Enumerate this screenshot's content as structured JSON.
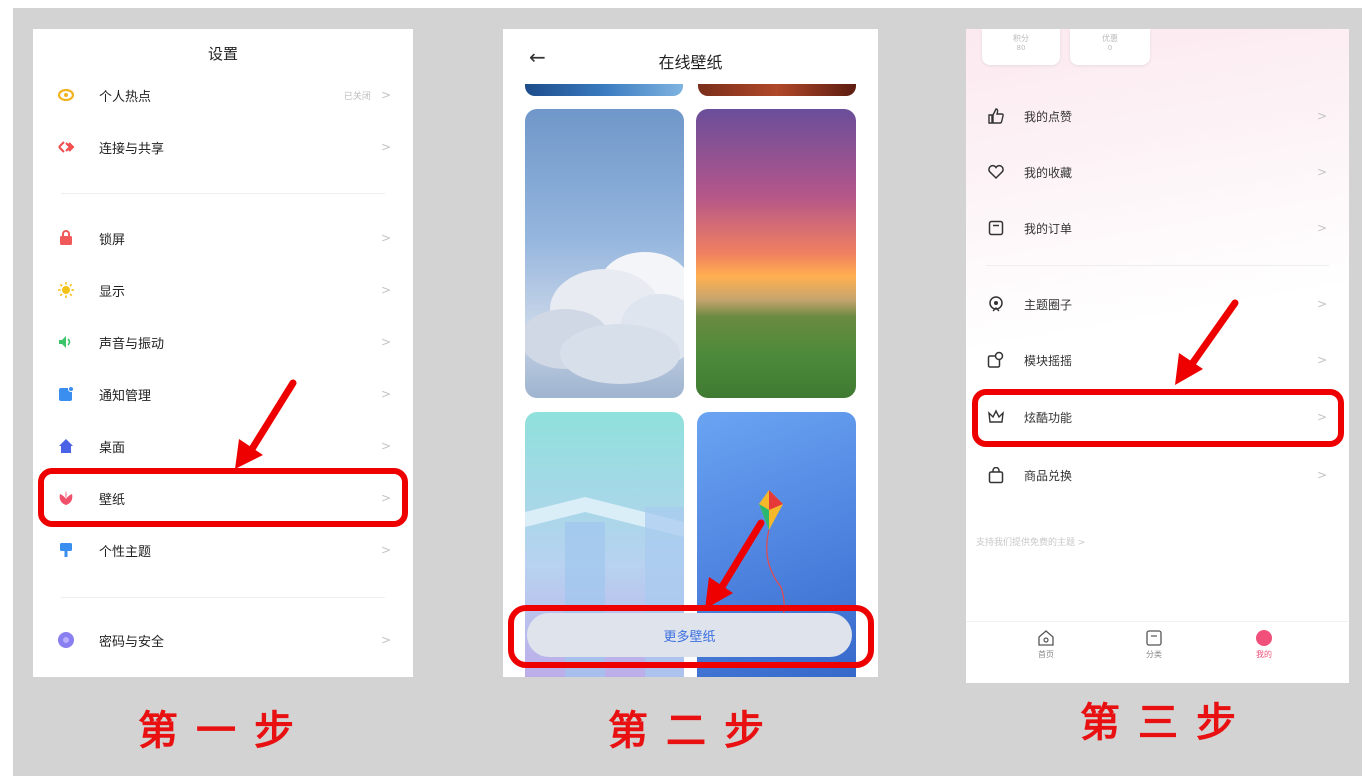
{
  "panel1": {
    "title": "设置",
    "items": [
      {
        "label": "个人热点",
        "value": "已关闭",
        "icon": "hotspot-icon",
        "color": "#f2b321"
      },
      {
        "label": "连接与共享",
        "icon": "connection-icon",
        "color": "#f04a4a"
      },
      {
        "label": "锁屏",
        "icon": "lock-icon",
        "color": "#f05a5a"
      },
      {
        "label": "显示",
        "icon": "sun-icon",
        "color": "#f5c21b"
      },
      {
        "label": "声音与振动",
        "icon": "speaker-icon",
        "color": "#3cc46a"
      },
      {
        "label": "通知管理",
        "icon": "notification-icon",
        "color": "#3a8ef0"
      },
      {
        "label": "桌面",
        "icon": "home-icon",
        "color": "#4a63e6"
      },
      {
        "label": "壁纸",
        "icon": "wallpaper-flower-icon",
        "color": "#f0506a"
      },
      {
        "label": "个性主题",
        "icon": "theme-brush-icon",
        "color": "#3a8ef0"
      },
      {
        "label": "密码与安全",
        "icon": "security-icon",
        "color": "#8a7ff0"
      }
    ],
    "chevron": ">"
  },
  "panel2": {
    "title": "在线壁纸",
    "back": "←",
    "button": "更多壁纸"
  },
  "panel3": {
    "top_cards": [
      {
        "label": "积分",
        "value": "80"
      },
      {
        "label": "优惠",
        "value": "0"
      }
    ],
    "items": [
      {
        "label": "我的点赞",
        "icon": "thumbs-up-icon"
      },
      {
        "label": "我的收藏",
        "icon": "heart-icon"
      },
      {
        "label": "我的订单",
        "icon": "order-icon"
      },
      {
        "label": "主题圈子",
        "icon": "circle-icon"
      },
      {
        "label": "模块摇摇",
        "icon": "module-icon"
      },
      {
        "label": "炫酷功能",
        "icon": "crown-icon"
      },
      {
        "label": "商品兑换",
        "icon": "shopping-bag-icon"
      }
    ],
    "support_text": "支持我们提供免费的主题 >",
    "nav": [
      {
        "label": "首页",
        "icon": "home-nav-icon"
      },
      {
        "label": "分类",
        "icon": "category-nav-icon"
      },
      {
        "label": "我的",
        "icon": "profile-nav-icon"
      }
    ],
    "chevron": ">"
  },
  "steps": [
    "第一步",
    "第二步",
    "第三步"
  ],
  "colors": {
    "annotation_red": "#e00000",
    "accent_pink": "#f0507a",
    "link_blue": "#3a6fe0"
  }
}
